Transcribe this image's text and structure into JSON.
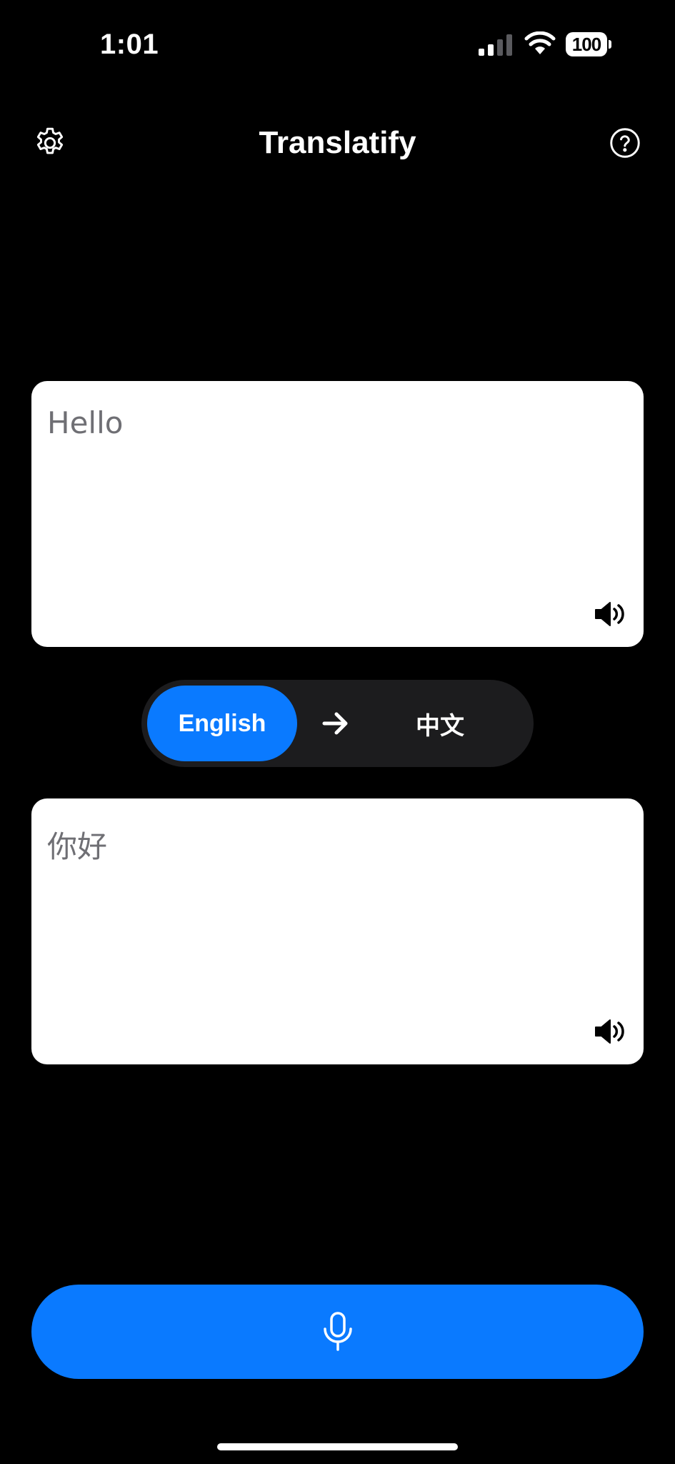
{
  "status_bar": {
    "time": "1:01",
    "battery": "100",
    "icons": [
      "cellular-signal-icon",
      "wifi-icon",
      "battery-icon"
    ]
  },
  "header": {
    "title": "Translatify",
    "left_icon": "gear-icon",
    "right_icon": "question-circle-icon"
  },
  "source_card": {
    "text": "Hello",
    "icon": "speaker-icon"
  },
  "language_switcher": {
    "source_language": "English",
    "target_language": "中文",
    "arrow_icon": "arrow-right-icon"
  },
  "target_card": {
    "text": "你好",
    "icon": "speaker-icon"
  },
  "mic_button": {
    "icon": "microphone-icon"
  },
  "colors": {
    "background": "#000000",
    "accent": "#0a7aff",
    "card": "#ffffff",
    "pill": "#1c1c1e",
    "card_text": "#6f6f74"
  }
}
